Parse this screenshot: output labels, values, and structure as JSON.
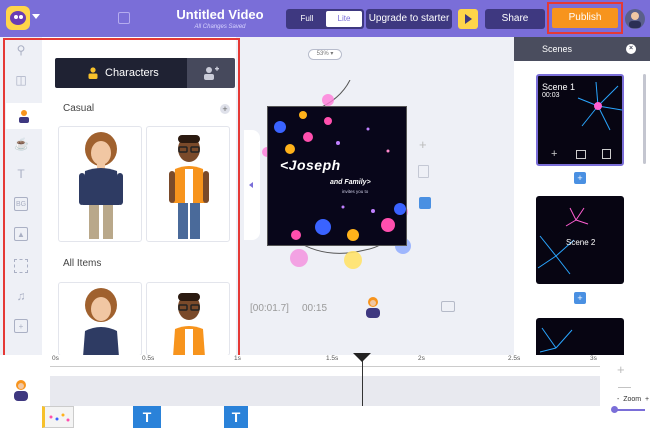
{
  "header": {
    "title": "Untitled Video",
    "subtitle": "All Changes Saved",
    "mode_full": "Full",
    "mode_lite": "Lite",
    "upgrade": "Upgrade to starter",
    "share": "Share",
    "publish": "Publish"
  },
  "library": {
    "tab_characters": "Characters",
    "section_casual": "Casual",
    "section_all": "All Items",
    "plus": "+"
  },
  "canvas": {
    "zoom": "53% ▾",
    "headline": "<Joseph",
    "subline": "and Family>",
    "invite": "invites you to",
    "time_current": "[00:01.7]",
    "time_total": "00:15",
    "plus": "+"
  },
  "scenes": {
    "title": "Scenes",
    "close": "×",
    "items": [
      {
        "label": "Scene 1",
        "time": "00:03"
      },
      {
        "label": "Scene 2"
      }
    ],
    "add": "+"
  },
  "timeline": {
    "ticks": [
      "0s",
      "0.5s",
      "1s",
      "1.5s",
      "2s",
      "2.5s",
      "3s"
    ],
    "zoom_label": "Zoom",
    "zoom_minus": "-",
    "zoom_plus": "+",
    "clip_text_glyph": "T"
  },
  "colors": {
    "brand": "#7a6ed8",
    "publish": "#f7941d",
    "highlight": "#e53935",
    "accent_blue": "#4a90e2"
  }
}
